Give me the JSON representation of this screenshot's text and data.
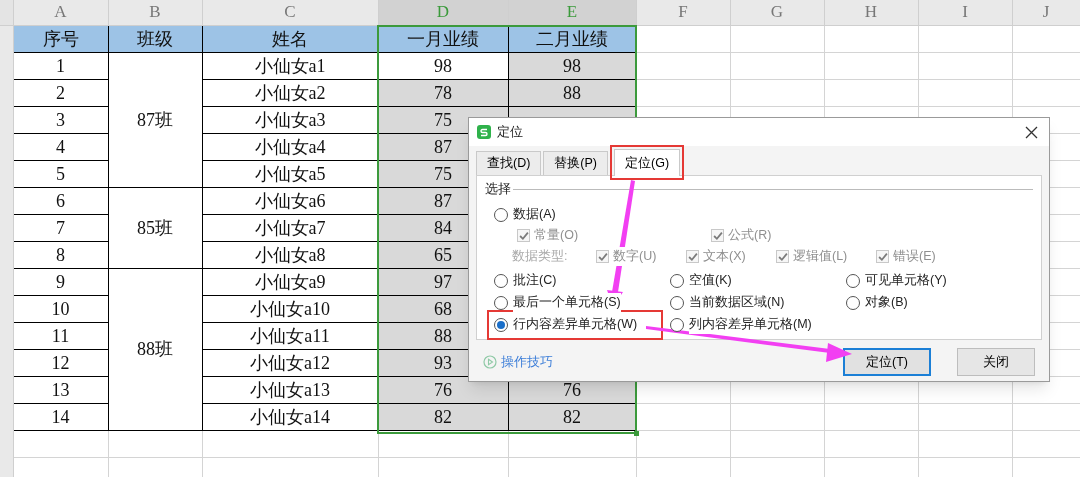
{
  "columns": [
    {
      "letter": "A",
      "selected": false
    },
    {
      "letter": "B",
      "selected": false
    },
    {
      "letter": "C",
      "selected": false
    },
    {
      "letter": "D",
      "selected": true
    },
    {
      "letter": "E",
      "selected": true
    },
    {
      "letter": "F",
      "selected": false
    },
    {
      "letter": "G",
      "selected": false
    },
    {
      "letter": "H",
      "selected": false
    },
    {
      "letter": "I",
      "selected": false
    },
    {
      "letter": "J",
      "selected": false
    }
  ],
  "header": [
    "序号",
    "班级",
    "姓名",
    "一月业绩",
    "二月业绩"
  ],
  "groups": [
    {
      "label": "87班",
      "rows": [
        {
          "no": "1",
          "name": "小仙女a1",
          "jan": "98",
          "feb": "98",
          "active": true
        },
        {
          "no": "2",
          "name": "小仙女a2",
          "jan": "78",
          "feb": "88",
          "active": false
        },
        {
          "no": "3",
          "name": "小仙女a3",
          "jan": "75",
          "active": false
        },
        {
          "no": "4",
          "name": "小仙女a4",
          "jan": "87",
          "active": false
        },
        {
          "no": "5",
          "name": "小仙女a5",
          "jan": "75",
          "active": false
        }
      ]
    },
    {
      "label": "85班",
      "rows": [
        {
          "no": "6",
          "name": "小仙女a6",
          "jan": "87",
          "active": false
        },
        {
          "no": "7",
          "name": "小仙女a7",
          "jan": "84",
          "active": false
        },
        {
          "no": "8",
          "name": "小仙女a8",
          "jan": "65",
          "active": false
        }
      ]
    },
    {
      "label": "88班",
      "rows": [
        {
          "no": "9",
          "name": "小仙女a9",
          "jan": "97",
          "active": false
        },
        {
          "no": "10",
          "name": "小仙女a10",
          "jan": "68",
          "active": false
        },
        {
          "no": "11",
          "name": "小仙女a11",
          "jan": "88",
          "active": false
        },
        {
          "no": "12",
          "name": "小仙女a12",
          "jan": "93",
          "active": false
        },
        {
          "no": "13",
          "name": "小仙女a13",
          "jan": "76",
          "feb": "76",
          "active": false
        },
        {
          "no": "14",
          "name": "小仙女a14",
          "jan": "82",
          "feb": "82",
          "active": false
        }
      ]
    }
  ],
  "dialog": {
    "title": "定位",
    "tabs": [
      {
        "label": "查找(D)",
        "selected": false,
        "annotated": false
      },
      {
        "label": "替换(P)",
        "selected": false,
        "annotated": false
      },
      {
        "label": "定位(G)",
        "selected": true,
        "annotated": true
      }
    ],
    "section_label": "选择",
    "data_option": {
      "label": "数据(A)",
      "selected": false
    },
    "data_subs": [
      {
        "label": "常量(O)",
        "checked": true,
        "disabled": true
      },
      {
        "label": "公式(R)",
        "checked": true,
        "disabled": true
      }
    ],
    "data_type_label": "数据类型:",
    "data_types": [
      {
        "label": "数字(U)",
        "checked": true,
        "disabled": true
      },
      {
        "label": "文本(X)",
        "checked": true,
        "disabled": true
      },
      {
        "label": "逻辑值(L)",
        "checked": true,
        "disabled": true
      },
      {
        "label": "错误(E)",
        "checked": true,
        "disabled": true
      }
    ],
    "radio_rows": [
      [
        {
          "label": "批注(C)",
          "selected": false,
          "annotated": false
        },
        {
          "label": "空值(K)",
          "selected": false,
          "annotated": false
        },
        {
          "label": "可见单元格(Y)",
          "selected": false,
          "annotated": false
        }
      ],
      [
        {
          "label": "最后一个单元格(S)",
          "selected": false,
          "annotated": false
        },
        {
          "label": "当前数据区域(N)",
          "selected": false,
          "annotated": false
        },
        {
          "label": "对象(B)",
          "selected": false,
          "annotated": false
        }
      ],
      [
        {
          "label": "行内容差异单元格(W)",
          "selected": true,
          "annotated": true
        },
        {
          "label": "列内容差异单元格(M)",
          "selected": false,
          "annotated": false
        }
      ]
    ],
    "tips_link": "操作技巧",
    "buttons": [
      {
        "label": "定位(T)",
        "default": true
      },
      {
        "label": "关闭",
        "default": false
      }
    ]
  }
}
